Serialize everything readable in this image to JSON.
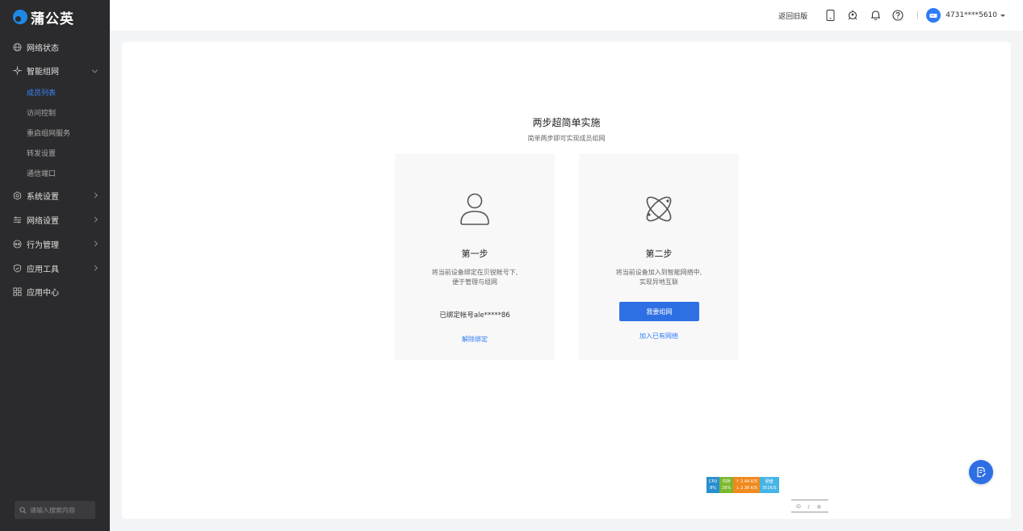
{
  "app": {
    "logo_text": "蒲公英"
  },
  "sidebar": {
    "items": [
      {
        "label": "网络状态",
        "icon": "globe-icon"
      },
      {
        "label": "智能组网",
        "icon": "network-icon",
        "expanded": true,
        "children": [
          "成员列表",
          "访问控制",
          "重启组网服务",
          "转发设置",
          "通信端口"
        ]
      },
      {
        "label": "系统设置",
        "icon": "gear-icon"
      },
      {
        "label": "网络设置",
        "icon": "sliders-icon"
      },
      {
        "label": "行为管理",
        "icon": "eye-icon"
      },
      {
        "label": "应用工具",
        "icon": "shield-icon"
      },
      {
        "label": "应用中心",
        "icon": "apps-grid-icon"
      }
    ],
    "active_child": "成员列表",
    "search_placeholder": "请输入搜索内容"
  },
  "header": {
    "back_to_old": "返回旧版",
    "account": "4731****5610"
  },
  "main": {
    "title": "两步超简单实施",
    "subtitle": "简单两步即可实现成员组网",
    "step1": {
      "title": "第一步",
      "desc_line1": "将当前设备绑定在贝锐帐号下,",
      "desc_line2": "便于管理与组网",
      "bound": "已绑定帐号ale*****86",
      "unbind": "解除绑定"
    },
    "step2": {
      "title": "第二步",
      "desc_line1": "将当前设备加入到智能网络中,",
      "desc_line2": "实现异地互联",
      "button": "我要组网",
      "join_link": "加入已有网络"
    }
  },
  "monitor": {
    "cpu_label": "CPU",
    "cpu_value": "8%",
    "mem_label": "内存",
    "mem_value": "26%",
    "up": "2.44 K/S",
    "down": "2.36 K/S",
    "disk_label": "硬盘",
    "disk_value": "351K/S"
  },
  "ime": {
    "text": "中 ♪ ⚙"
  },
  "colors": {
    "accent": "#2f6fe4",
    "sidebar_bg": "#2b2b2d",
    "active_text": "#3a86ff"
  }
}
